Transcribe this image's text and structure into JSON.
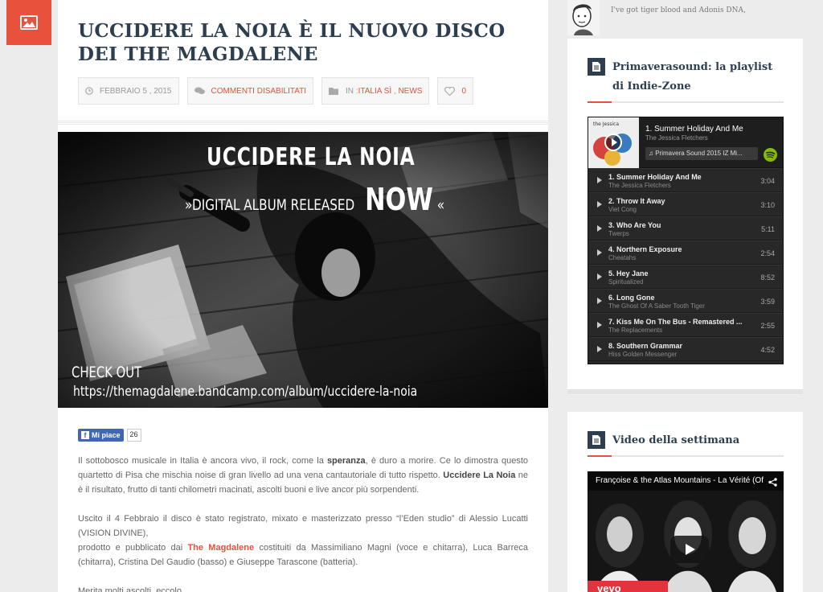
{
  "post": {
    "title": "UCCIDERE LA NOIA È IL NUOVO DISCO DEI THE MAGDALENE",
    "date": "FEBBRAIO 5 , 2015",
    "comments": "COMMENTI DISABILITATI",
    "in_label": "IN : ",
    "category1": "ITALIA SÌ",
    "cat_sep": " , ",
    "category2": "NEWS",
    "likes": "0",
    "hero": {
      "line1": "UCCIDERE LA NOIA",
      "line2_pre": "»DIGITAL ALBUM RELEASED",
      "line2_now": "NOW",
      "line2_post": "«",
      "check": "CHECK OUT",
      "url": "https://themagdalene.bandcamp.com/album/uccidere-la-noia"
    },
    "fb_like_label": "Mi piace",
    "fb_like_count": "26",
    "p1_a": "Il sottobosco musicale in Italia è ancora vivo, il rock, come la ",
    "p1_b": "speranza",
    "p1_c": ", è duro a morire. Ce lo dimostra questo quartetto di Pisa che mischia noise di gran livello ad una vena cantautoriale di tutto rispetto. ",
    "p1_d": "Uccidere La Noia",
    "p1_e": " ne è il risultato, frutto di tanti chilometri macinati, ascolti buoni e live ancor più sorpendenti.",
    "p2_a": "Uscito il 4 Febbraio il disco è stato registrato, mixato e masterizzato presso “l’Eden studio” di Alessio Lucatti (VISION DIVINE),",
    "p2_b": "prodotto e pubblicato dai ",
    "p2_c": "The Magdalene",
    "p2_d": " costituiti da Massimiliano Magni (voce e chitarra), Luca Barreca (chitarra), Cristina Del Gaudio (basso) e Giuseppe Tarascone (batteria).",
    "p3": "Merita molti ascolti, eccolo."
  },
  "sidebar": {
    "quote": "I've got tiger blood and Adonis DNA,",
    "widget1_title": "Primaverasound: la playlist di Indie-Zone",
    "widget2_title": "Video della settimana"
  },
  "spotify": {
    "now_title": "1. Summer Holiday And Me",
    "now_artist": "The Jessica Fletchers",
    "playlist": "♫ Primavera Sound 2015 IZ Mi...",
    "tracks": [
      {
        "title": "1. Summer Holiday And Me",
        "artist": "The Jessica Fletchers",
        "dur": "3:04"
      },
      {
        "title": "2. Throw It Away",
        "artist": "Viet Cong",
        "dur": "3:10"
      },
      {
        "title": "3. Who Are You",
        "artist": "Twerps",
        "dur": "5:11"
      },
      {
        "title": "4. Northern Exposure",
        "artist": "Cheatahs",
        "dur": "2:54"
      },
      {
        "title": "5. Hey Jane",
        "artist": "Spiritualized",
        "dur": "8:52"
      },
      {
        "title": "6. Long Gone",
        "artist": "The Ghost Of A Saber Tooth Tiger",
        "dur": "3:59"
      },
      {
        "title": "7. Kiss Me On The Bus - Remastered ...",
        "artist": "The Replacements",
        "dur": "2:55"
      },
      {
        "title": "8. Southern Grammar",
        "artist": "Hiss Golden Messenger",
        "dur": "4:52"
      }
    ]
  },
  "video": {
    "title": "Françoise & the Atlas Mountains - La Vérité (Of...",
    "badge": "vevo"
  },
  "colors": {
    "accent": "#e8513b",
    "heading": "#2d3e50",
    "spotify_green": "#84bd00"
  }
}
